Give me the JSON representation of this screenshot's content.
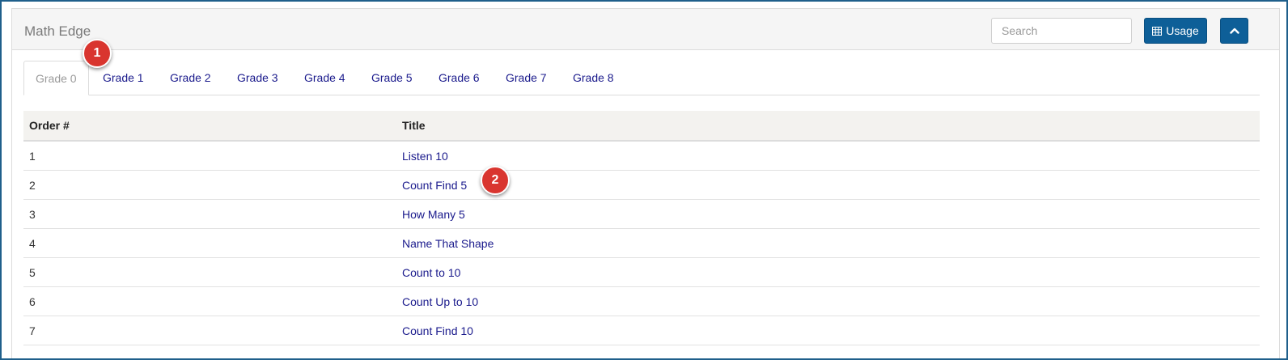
{
  "panel": {
    "title": "Math Edge",
    "search_placeholder": "Search",
    "usage_label": "Usage",
    "usage_icon": "table-icon",
    "collapse_icon": "chevron-up-icon"
  },
  "tabs": [
    {
      "label": "Grade 0",
      "active": true
    },
    {
      "label": "Grade 1"
    },
    {
      "label": "Grade 2"
    },
    {
      "label": "Grade 3"
    },
    {
      "label": "Grade 4"
    },
    {
      "label": "Grade 5"
    },
    {
      "label": "Grade 6"
    },
    {
      "label": "Grade 7"
    },
    {
      "label": "Grade 8"
    }
  ],
  "table": {
    "headers": [
      "Order #",
      "Title"
    ],
    "rows": [
      {
        "order": "1",
        "title": "Listen 10"
      },
      {
        "order": "2",
        "title": "Count Find 5"
      },
      {
        "order": "3",
        "title": "How Many 5"
      },
      {
        "order": "4",
        "title": "Name That Shape"
      },
      {
        "order": "5",
        "title": "Count to 10"
      },
      {
        "order": "6",
        "title": "Count Up to 10"
      },
      {
        "order": "7",
        "title": "Count Find 10"
      }
    ]
  },
  "annotations": [
    "1",
    "2"
  ],
  "colors": {
    "accent": "#0e5f98",
    "link": "#1a1a8c",
    "badge": "#d9352f"
  }
}
